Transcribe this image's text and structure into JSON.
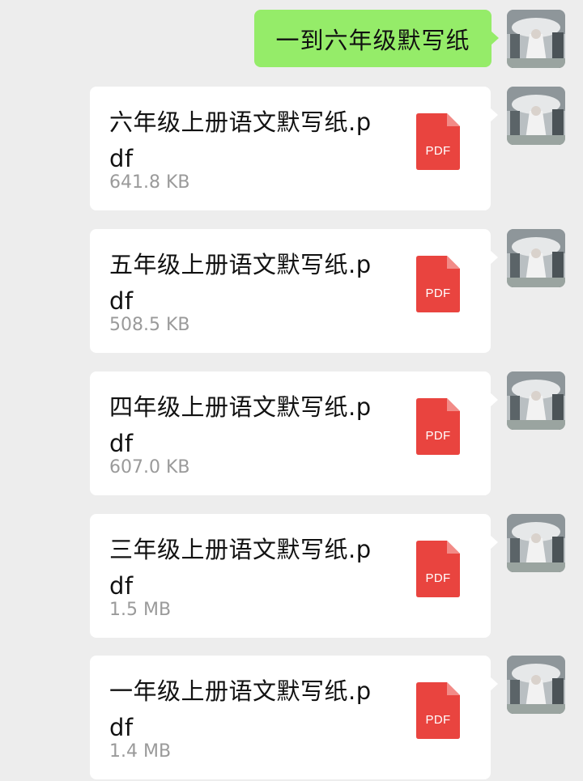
{
  "chat": {
    "messages": [
      {
        "type": "text",
        "text": "一到六年级默写纸"
      },
      {
        "type": "file",
        "name": "六年级上册语文默写纸.pdf",
        "size": "641.8 KB",
        "icon_label": "PDF"
      },
      {
        "type": "file",
        "name": "五年级上册语文默写纸.pdf",
        "size": "508.5 KB",
        "icon_label": "PDF"
      },
      {
        "type": "file",
        "name": "四年级上册语文默写纸.pdf",
        "size": "607.0 KB",
        "icon_label": "PDF"
      },
      {
        "type": "file",
        "name": "三年级上册语文默写纸.pdf",
        "size": "1.5 MB",
        "icon_label": "PDF"
      },
      {
        "type": "file",
        "name": "一年级上册语文默写纸.pdf",
        "size": "1.4 MB",
        "icon_label": "PDF"
      }
    ]
  },
  "colors": {
    "background": "#ededed",
    "sent_bubble": "#95ec69",
    "file_card": "#ffffff",
    "pdf_icon": "#e9443f",
    "file_size_text": "#9a9a9a"
  },
  "icons": {
    "file": "pdf-file-icon",
    "avatar": "user-avatar"
  }
}
